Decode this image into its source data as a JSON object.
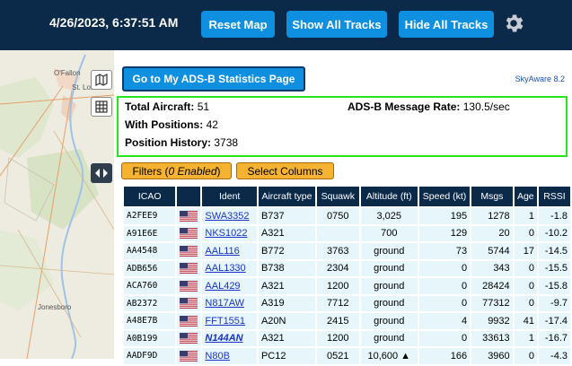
{
  "header": {
    "clock": "4/26/2023, 6:37:51 AM",
    "reset_map": "Reset Map",
    "show_all_tracks": "Show All Tracks",
    "hide_all_tracks": "Hide All Tracks"
  },
  "map": {
    "cities": {
      "ofallon": "O'Fallon",
      "stlouis": "St. Louis",
      "jonesboro": "Jonesboro"
    }
  },
  "panel": {
    "stats_button": "Go to My ADS-B Statistics Page",
    "version": "SkyAware 8.2",
    "stats": {
      "total_aircraft_label": "Total Aircraft:",
      "total_aircraft_value": "51",
      "with_positions_label": "With Positions:",
      "with_positions_value": "42",
      "position_history_label": "Position History:",
      "position_history_value": "3738",
      "message_rate_label": "ADS-B Message Rate:",
      "message_rate_value": "130.5/sec"
    },
    "filters_label": "Filters (",
    "filters_enabled": "0 Enabled",
    "filters_close": ")",
    "select_columns": "Select Columns"
  },
  "table": {
    "headers": [
      "ICAO",
      "",
      "Ident",
      "Aircraft type",
      "Squawk",
      "Altitude (ft)",
      "Speed (kt)",
      "Msgs",
      "Age",
      "RSSI"
    ],
    "rows": [
      {
        "icao": "A2FEE9",
        "ident": "SWA3352",
        "type": "B737",
        "squawk": "0750",
        "alt": "3,025",
        "speed": "195",
        "msgs": "1278",
        "age": "1",
        "rssi": "-1.8"
      },
      {
        "icao": "A91E6E",
        "ident": "NKS1022",
        "type": "A321",
        "squawk": "",
        "alt": "700",
        "speed": "129",
        "msgs": "20",
        "age": "0",
        "rssi": "-10.2"
      },
      {
        "icao": "AA4548",
        "ident": "AAL116",
        "type": "B772",
        "squawk": "3763",
        "alt": "ground",
        "speed": "73",
        "msgs": "5744",
        "age": "17",
        "rssi": "-14.5"
      },
      {
        "icao": "ADB656",
        "ident": "AAL1330",
        "type": "B738",
        "squawk": "2304",
        "alt": "ground",
        "speed": "0",
        "msgs": "343",
        "age": "0",
        "rssi": "-15.5"
      },
      {
        "icao": "ACA760",
        "ident": "AAL429",
        "type": "A321",
        "squawk": "1200",
        "alt": "ground",
        "speed": "0",
        "msgs": "28424",
        "age": "0",
        "rssi": "-15.8"
      },
      {
        "icao": "AB2372",
        "ident": "N817AW",
        "type": "A319",
        "squawk": "7712",
        "alt": "ground",
        "speed": "0",
        "msgs": "77312",
        "age": "0",
        "rssi": "-9.7"
      },
      {
        "icao": "A48E7B",
        "ident": "FFT1551",
        "type": "A20N",
        "squawk": "2415",
        "alt": "ground",
        "speed": "4",
        "msgs": "9932",
        "age": "41",
        "rssi": "-17.4"
      },
      {
        "icao": "A0B199",
        "ident": "N144AN",
        "type": "A321",
        "squawk": "1200",
        "alt": "ground",
        "speed": "0",
        "msgs": "33613",
        "age": "1",
        "rssi": "-16.7"
      },
      {
        "icao": "AADF9D",
        "ident": "N80B",
        "type": "PC12",
        "squawk": "0521",
        "alt": "10,600 ▲",
        "speed": "166",
        "msgs": "3960",
        "age": "0",
        "rssi": "-4.3"
      }
    ]
  },
  "icons": {
    "gear": "gear-icon",
    "layers": "map-layers-icon",
    "grid": "grid-icon",
    "toggle": "sidebar-toggle-icon",
    "flag": "us-flag-icon"
  }
}
